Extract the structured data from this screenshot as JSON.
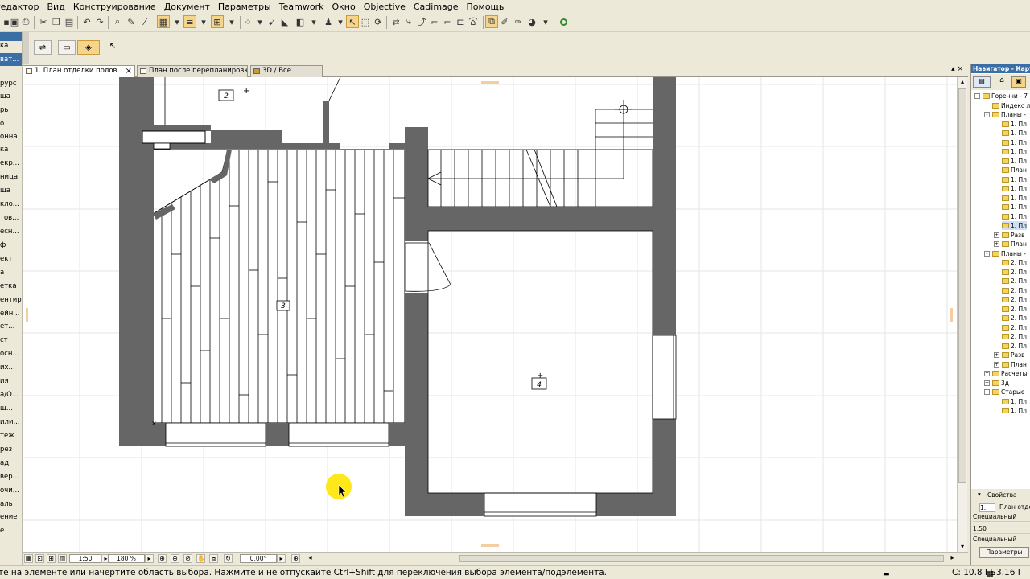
{
  "menu": [
    "Редактор",
    "Вид",
    "Конструирование",
    "Документ",
    "Параметры",
    "Teamwork",
    "Окно",
    "Objective",
    "Cadimage",
    "Помощь"
  ],
  "toolbox_items": [
    "ка",
    "ват...",
    "рурс",
    "ша",
    "рь",
    "о",
    "онна",
    "ка",
    "екр...",
    "ница",
    "ша",
    "кло...",
    "тов...",
    "есн...",
    "ф",
    "ект",
    "а",
    "етка",
    "ентир",
    "ейн...",
    "ет...",
    "ст",
    "осн...",
    "их...",
    "ия",
    "а/О...",
    "ш...",
    "или...",
    "теж",
    "рез",
    "ад",
    "вер...",
    "очи...",
    "аль",
    "ение",
    "е"
  ],
  "tabs": [
    {
      "label": "1. План отделки полов",
      "active": true
    },
    {
      "label": "План после перепланировки...",
      "active": false
    },
    {
      "label": "3D / Все",
      "active": false
    }
  ],
  "rooms": [
    {
      "number": "2"
    },
    {
      "number": "3"
    },
    {
      "number": "4"
    }
  ],
  "bottom": {
    "scale": "1:50",
    "zoom": "180 %",
    "angle": "0,00°"
  },
  "status": {
    "message": "те на элементе или начертите область выбора. Нажмите и не отпускайте Ctrl+Shift для переключения выбора элемента/подэлемента.",
    "disk": "C: 10.8 ГБ",
    "memory": "3.16 Г"
  },
  "navigator": {
    "title": "Навигатор - Карта",
    "tree": [
      {
        "label": "Горенчи - 7",
        "level": 0,
        "exp": "-"
      },
      {
        "label": "Индекс л",
        "level": 1
      },
      {
        "label": "Планы -",
        "level": 1,
        "exp": "-"
      },
      {
        "label": "1. Пл",
        "level": 2
      },
      {
        "label": "1. Пл",
        "level": 2
      },
      {
        "label": "1. Пл",
        "level": 2
      },
      {
        "label": "1. Пл",
        "level": 2
      },
      {
        "label": "1. Пл",
        "level": 2
      },
      {
        "label": "План",
        "level": 2
      },
      {
        "label": "1. Пл",
        "level": 2
      },
      {
        "label": "1. Пл",
        "level": 2
      },
      {
        "label": "1. Пл",
        "level": 2
      },
      {
        "label": "1. Пл",
        "level": 2
      },
      {
        "label": "1. Пл",
        "level": 2
      },
      {
        "label": "1. Пл",
        "level": 2,
        "selected": true
      },
      {
        "label": "Разв",
        "level": 2,
        "exp": "+"
      },
      {
        "label": "План",
        "level": 2,
        "exp": "+"
      },
      {
        "label": "Планы -",
        "level": 1,
        "exp": "-"
      },
      {
        "label": "2. Пл",
        "level": 2
      },
      {
        "label": "2. Пл",
        "level": 2
      },
      {
        "label": "2. Пл",
        "level": 2
      },
      {
        "label": "2. Пл",
        "level": 2
      },
      {
        "label": "2. Пл",
        "level": 2
      },
      {
        "label": "2. Пл",
        "level": 2
      },
      {
        "label": "2. Пл",
        "level": 2
      },
      {
        "label": "2. Пл",
        "level": 2
      },
      {
        "label": "2. Пл",
        "level": 2
      },
      {
        "label": "2. Пл",
        "level": 2
      },
      {
        "label": "Разв",
        "level": 2,
        "exp": "+"
      },
      {
        "label": "План",
        "level": 2,
        "exp": "+"
      },
      {
        "label": "Расчеты",
        "level": 1,
        "exp": "+"
      },
      {
        "label": "3д",
        "level": 1,
        "exp": "+"
      },
      {
        "label": "Старые",
        "level": 1,
        "exp": "-"
      },
      {
        "label": "1. Пл",
        "level": 2
      },
      {
        "label": "1. Пл",
        "level": 2
      }
    ],
    "props_title": "Свойства",
    "props": [
      {
        "id": "1.",
        "value": "План отдел"
      },
      {
        "id": "",
        "value": "Специальный"
      },
      {
        "id": "",
        "value": "1:50"
      },
      {
        "id": "",
        "value": "Специальный"
      }
    ],
    "params_button": "Параметры"
  }
}
